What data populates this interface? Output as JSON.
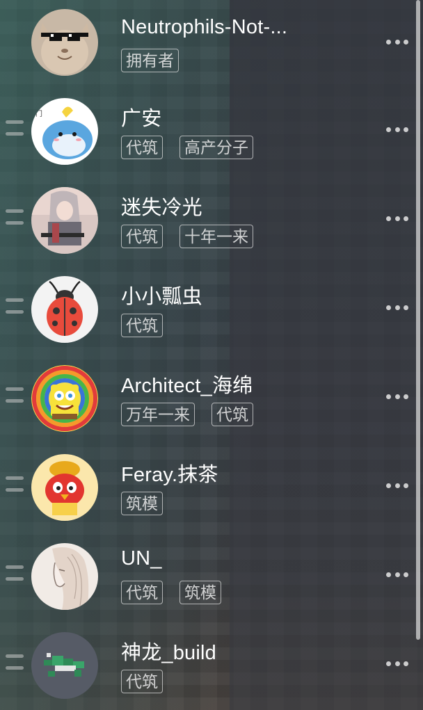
{
  "members": [
    {
      "name": "Neutrophils-Not-...",
      "tags": [
        "拥有者"
      ],
      "avatar_icon": "cat-sunglasses-avatar",
      "drag_handle": false
    },
    {
      "name": "广安",
      "tags": [
        "代筑",
        "高产分子"
      ],
      "avatar_icon": "cartoon-seal-avatar",
      "drag_handle": true
    },
    {
      "name": "迷失冷光",
      "tags": [
        "代筑",
        "十年一来"
      ],
      "avatar_icon": "anime-soldier-avatar",
      "drag_handle": true
    },
    {
      "name": "小小瓢虫",
      "tags": [
        "代筑"
      ],
      "avatar_icon": "ladybug-avatar",
      "drag_handle": true
    },
    {
      "name": "Architect_海绵",
      "tags": [
        "万年一来",
        "代筑"
      ],
      "avatar_icon": "spongebob-rainbow-avatar",
      "drag_handle": true
    },
    {
      "name": "Feray.抹茶",
      "tags": [
        "筑模"
      ],
      "avatar_icon": "red-cartoon-bird-avatar",
      "drag_handle": true
    },
    {
      "name": "UN_",
      "tags": [
        "代筑",
        "筑模"
      ],
      "avatar_icon": "sketch-portrait-avatar",
      "drag_handle": true
    },
    {
      "name": "神龙_build",
      "tags": [
        "代筑"
      ],
      "avatar_icon": "pixel-dragon-avatar",
      "drag_handle": true
    }
  ],
  "icons": {
    "drag": "drag-handle-icon",
    "more": "more-horizontal-icon"
  }
}
